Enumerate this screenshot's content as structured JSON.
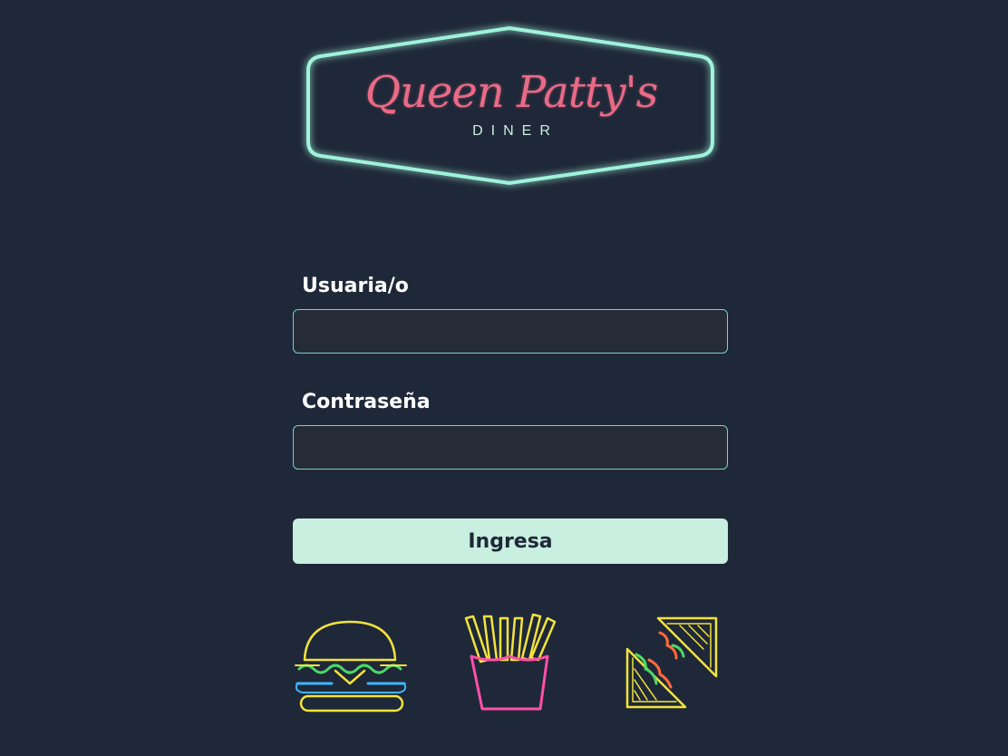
{
  "logo": {
    "script_text": "Queen Patty's",
    "sub_text": "DINER"
  },
  "form": {
    "username_label": "Usuaria/o",
    "username_value": "",
    "password_label": "Contraseña",
    "password_value": "",
    "submit_label": "Ingresa"
  },
  "icons": [
    "burger-icon",
    "fries-icon",
    "sandwich-icon"
  ],
  "colors": {
    "background": "#1f2838",
    "neon_mint": "#9ff2dc",
    "logo_pink": "#e96a87",
    "input_border": "#74d3c4",
    "button_bg": "#c8efe0",
    "neon_yellow": "#f3e33c",
    "neon_pink": "#ff4fa8",
    "neon_green": "#4cd964",
    "neon_blue": "#3fb6ff"
  }
}
